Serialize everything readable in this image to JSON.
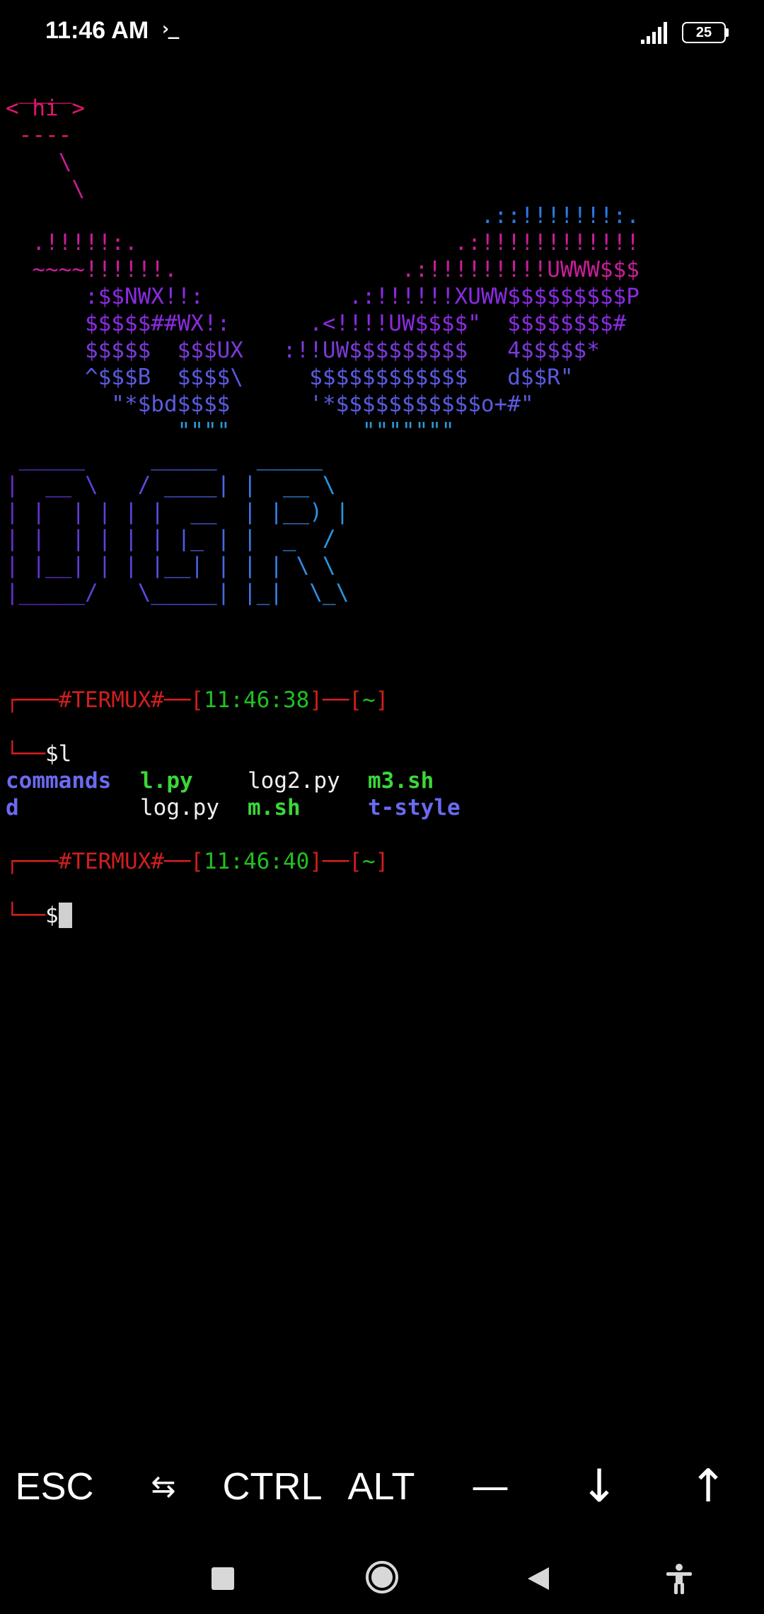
{
  "status_bar": {
    "time": "11:46 AM",
    "app_indicator": "›_",
    "battery_level": "25",
    "icons": [
      "termux-icon",
      "signal-icon",
      "battery-icon"
    ]
  },
  "terminal": {
    "cowsay": {
      "top": " ____",
      "bubble": "< hi >",
      "bottom": " ----",
      "tail1": "    \\",
      "tail2": "     \\"
    },
    "whale": [
      "                                    .::!!!!!!!:.",
      "  .!!!!!:.                        .:!!!!!!!!!!!!",
      "  ~~~~!!!!!!.                 .:!!!!!!!!!UWWW$$$",
      "      :$$NWX!!:           .:!!!!!!XUWW$$$$$$$$$P",
      "      $$$$$##WX!:      .<!!!!UW$$$$\"  $$$$$$$$#",
      "      $$$$$  $$$UX   :!!UW$$$$$$$$$   4$$$$$*",
      "      ^$$$B  $$$$\\     $$$$$$$$$$$$   d$$R\"",
      "        \"*$bd$$$$      '*$$$$$$$$$$$o+#\"",
      "             \"\"\"\"          \"\"\"\"\"\"\""
    ],
    "banner": [
      " _____     _____   _____",
      "|  __ \\   / ____| |  __ \\",
      "| |  | | | |  __  | |__) |",
      "| |  | | | | |_ | |  _  /",
      "| |__| | | |__| | | | \\ \\",
      "|_____/   \\_____| |_|  \\_\\"
    ],
    "prompt1": {
      "corner": "┌───",
      "tag": "#TERMUX#",
      "sep1": "──[",
      "time": "11:46:38",
      "sep2": "]──[",
      "dir": "~",
      "end": "]",
      "line2_corner": "└──",
      "prompt_sign": "$",
      "command": "l"
    },
    "ls_output": {
      "row1": [
        {
          "name": "commands",
          "type": "dir"
        },
        {
          "name": "l.py",
          "type": "exec"
        },
        {
          "name": "log2.py",
          "type": "file"
        },
        {
          "name": "m3.sh",
          "type": "exec"
        }
      ],
      "row2": [
        {
          "name": "d",
          "type": "dir"
        },
        {
          "name": "log.py",
          "type": "file"
        },
        {
          "name": "m.sh",
          "type": "exec"
        },
        {
          "name": "t-style",
          "type": "dir"
        }
      ]
    },
    "prompt2": {
      "corner": "┌───",
      "tag": "#TERMUX#",
      "sep1": "──[",
      "time": "11:46:40",
      "sep2": "]──[",
      "dir": "~",
      "end": "]",
      "line2_corner": "└──",
      "prompt_sign": "$"
    }
  },
  "extra_keys": {
    "esc": "ESC",
    "tab": "⇆",
    "ctrl": "CTRL",
    "alt": "ALT",
    "dash": "—",
    "down": "↓",
    "up": "↑"
  },
  "colors": {
    "background": "#000000",
    "prompt_red": "#d01e1e",
    "prompt_green": "#21c021",
    "ls_dir": "#6a6af0",
    "ls_exec": "#3ad83a"
  }
}
